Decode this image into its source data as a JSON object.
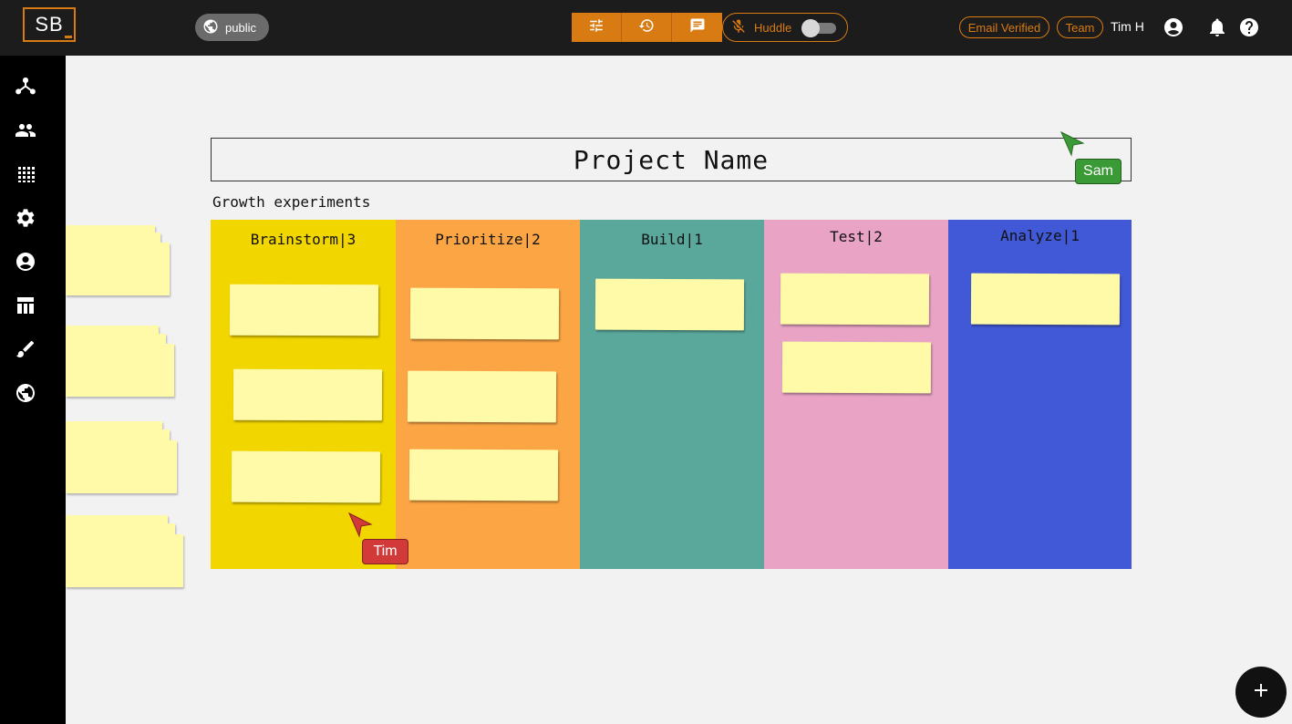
{
  "header": {
    "logo_text": "SB",
    "visibility_label": "public",
    "huddle_label": "Huddle",
    "huddle_on": false,
    "email_verified_label": "Email Verified",
    "team_label": "Team",
    "username": "Tim H",
    "accent_color": "#d97b13"
  },
  "sidebar": {
    "items": [
      {
        "icon": "graph-icon"
      },
      {
        "icon": "people-icon"
      },
      {
        "icon": "grid-icon"
      },
      {
        "icon": "gear-icon"
      },
      {
        "icon": "account-icon"
      },
      {
        "icon": "table-layout-icon"
      },
      {
        "icon": "brush-icon"
      },
      {
        "icon": "globe-icon"
      }
    ]
  },
  "board": {
    "project_title": "Project Name",
    "subtitle": "Growth experiments",
    "columns": [
      {
        "title": "Brainstorm|3",
        "color": "#f2d600",
        "notes": 3
      },
      {
        "title": "Prioritize|2",
        "color": "#fba544",
        "notes": 3
      },
      {
        "title": "Build|1",
        "color": "#5aa89c",
        "notes": 1
      },
      {
        "title": "Test|2",
        "color": "#e8a3c5",
        "notes": 2
      },
      {
        "title": "Analyze|1",
        "color": "#4159d6",
        "notes": 1
      }
    ]
  },
  "cursors": [
    {
      "name": "Sam",
      "color": "#3a9a35"
    },
    {
      "name": "Tim",
      "color": "#d23a3a"
    }
  ]
}
